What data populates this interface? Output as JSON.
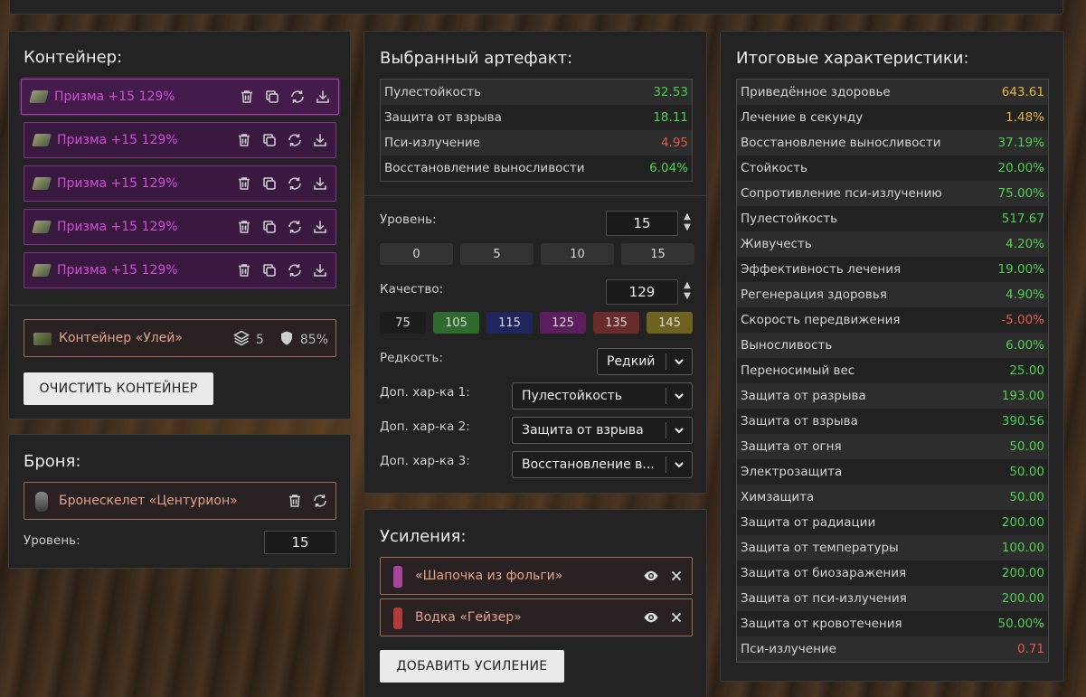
{
  "container": {
    "title": "Контейнер:",
    "slots": [
      {
        "name": "Призма +15 129%"
      },
      {
        "name": "Призма +15 129%"
      },
      {
        "name": "Призма +15 129%"
      },
      {
        "name": "Призма +15 129%"
      },
      {
        "name": "Призма +15 129%"
      }
    ],
    "container_item": {
      "name": "Контейнер «Улей»",
      "slots_count": "5",
      "protection": "85%"
    },
    "clear_label": "ОЧИСТИТЬ КОНТЕЙНЕР"
  },
  "armor": {
    "title": "Броня:",
    "item_name": "Бронескелет «Центурион»",
    "level_label": "Уровень:",
    "level_value": "15"
  },
  "artifact": {
    "title": "Выбранный артефакт:",
    "stats": [
      {
        "label": "Пулестойкость",
        "value": "32.53",
        "color": "green"
      },
      {
        "label": "Защита от взрыва",
        "value": "18.11",
        "color": "green"
      },
      {
        "label": "Пси-излучение",
        "value": "4.95",
        "color": "red"
      },
      {
        "label": "Восстановление выносливости",
        "value": "6.04%",
        "color": "green"
      }
    ],
    "level_label": "Уровень:",
    "level_value": "15",
    "level_presets": [
      "0",
      "5",
      "10",
      "15"
    ],
    "quality_label": "Качество:",
    "quality_value": "129",
    "quality_presets": [
      {
        "label": "75",
        "color": "#1c1c1c"
      },
      {
        "label": "105",
        "color": "#2f6b2f"
      },
      {
        "label": "115",
        "color": "#20255e"
      },
      {
        "label": "125",
        "color": "#5b1f5e"
      },
      {
        "label": "135",
        "color": "#6a2b2b"
      },
      {
        "label": "145",
        "color": "#6d6220"
      }
    ],
    "rarity_label": "Редкость:",
    "rarity_value": "Редкий",
    "extra1_label": "Доп. хар-ка 1:",
    "extra1_value": "Пулестойкость",
    "extra2_label": "Доп. хар-ка 2:",
    "extra2_value": "Защита от взрыва",
    "extra3_label": "Доп. хар-ка 3:",
    "extra3_value": "Восстановление в..."
  },
  "boosts": {
    "title": "Усиления:",
    "items": [
      {
        "name": "«Шапочка из фольги»",
        "icon_color": "#a8439c"
      },
      {
        "name": "Водка «Гейзер»",
        "icon_color": "#b23a3a"
      }
    ],
    "add_label": "ДОБАВИТЬ УСИЛЕНИЕ"
  },
  "totals": {
    "title": "Итоговые характеристики:",
    "rows": [
      {
        "label": "Приведённое здоровье",
        "value": "643.61",
        "color": "orange"
      },
      {
        "label": "Лечение в секунду",
        "value": "1.48%",
        "color": "orange"
      },
      {
        "label": "Восстановление выносливости",
        "value": "37.19%",
        "color": "green"
      },
      {
        "label": "Стойкость",
        "value": "20.00%",
        "color": "green"
      },
      {
        "label": "Сопротивление пси-излучению",
        "value": "75.00%",
        "color": "green"
      },
      {
        "label": "Пулестойкость",
        "value": "517.67",
        "color": "green"
      },
      {
        "label": "Живучесть",
        "value": "4.20%",
        "color": "green"
      },
      {
        "label": "Эффективность лечения",
        "value": "19.00%",
        "color": "green"
      },
      {
        "label": "Регенерация здоровья",
        "value": "4.90%",
        "color": "green"
      },
      {
        "label": "Скорость передвижения",
        "value": "-5.00%",
        "color": "red"
      },
      {
        "label": "Выносливость",
        "value": "6.00%",
        "color": "green"
      },
      {
        "label": "Переносимый вес",
        "value": "25.00",
        "color": "green"
      },
      {
        "label": "Защита от разрыва",
        "value": "193.00",
        "color": "green"
      },
      {
        "label": "Защита от взрыва",
        "value": "390.56",
        "color": "green"
      },
      {
        "label": "Защита от огня",
        "value": "50.00",
        "color": "green"
      },
      {
        "label": "Электрозащита",
        "value": "50.00",
        "color": "green"
      },
      {
        "label": "Химзащита",
        "value": "50.00",
        "color": "green"
      },
      {
        "label": "Защита от радиации",
        "value": "200.00",
        "color": "green"
      },
      {
        "label": "Защита от температуры",
        "value": "100.00",
        "color": "green"
      },
      {
        "label": "Защита от биозаражения",
        "value": "200.00",
        "color": "green"
      },
      {
        "label": "Защита от пси-излучения",
        "value": "200.00",
        "color": "green"
      },
      {
        "label": "Защита от кровотечения",
        "value": "50.00%",
        "color": "green"
      },
      {
        "label": "Пси-излучение",
        "value": "0.71",
        "color": "red"
      }
    ]
  }
}
